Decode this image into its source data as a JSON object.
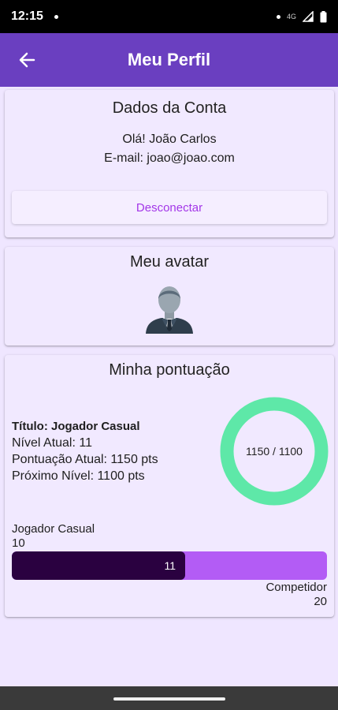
{
  "status_bar": {
    "time": "12:15",
    "network": "4G"
  },
  "app_bar": {
    "title": "Meu Perfil"
  },
  "account": {
    "title": "Dados da Conta",
    "greeting": "Olá! João Carlos",
    "email": "E-mail: joao@joao.com",
    "disconnect_label": "Desconectar"
  },
  "avatar_section": {
    "title": "Meu avatar"
  },
  "score": {
    "title": "Minha pontuação",
    "title_line": "Título: Jogador Casual",
    "level_line": "Nível Atual: 11",
    "points_line": "Pontuação Atual: 1150 pts",
    "next_line": "Próximo Nível: 1100 pts",
    "ring_label": "1150 / 1100",
    "ring_progress": 1.0,
    "current_rank": "Jogador Casual",
    "current_rank_level": "10",
    "progress_value": "11",
    "progress_fraction": 0.55,
    "next_rank": "Competidor",
    "next_rank_level": "20"
  },
  "colors": {
    "app_bar": "#6a3fc0",
    "ring": "#5ee8a8",
    "progress_fill": "#2a0140",
    "progress_track": "#b35cf5",
    "accent_text": "#a336e8"
  }
}
